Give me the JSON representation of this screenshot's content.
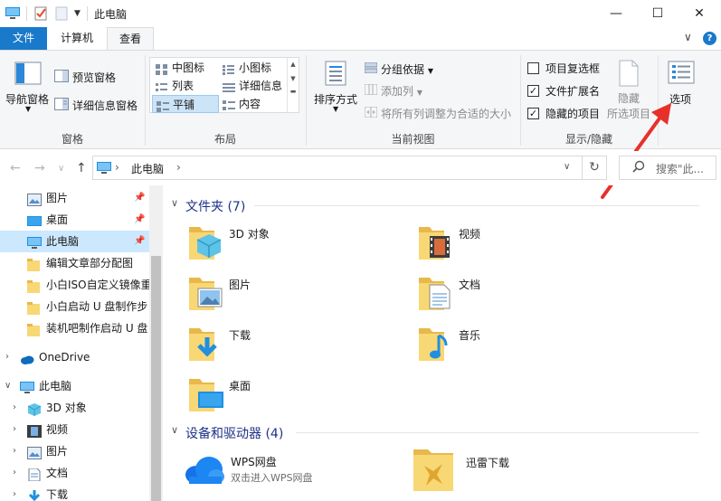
{
  "window": {
    "title": "此电脑",
    "controls": {
      "minimize": "—",
      "maximize": "☐",
      "close": "✕"
    }
  },
  "ribbon_tabs": {
    "file": "文件",
    "computer": "计算机",
    "view": "查看",
    "collapse": "∨",
    "help": "?"
  },
  "ribbon": {
    "panes": {
      "nav_pane": "导航窗格",
      "preview_pane": "预览窗格",
      "details_pane": "详细信息窗格",
      "group_label": "窗格"
    },
    "layout": {
      "items": [
        "中图标",
        "小图标",
        "列表",
        "详细信息",
        "平铺",
        "内容"
      ],
      "selected": "平铺",
      "group_label": "布局"
    },
    "current_view": {
      "sort_by": "排序方式",
      "group_by": "分组依据",
      "add_columns": "添加列",
      "fit_columns": "将所有列调整为合适的大小",
      "group_label": "当前视图"
    },
    "show_hide": {
      "item_checkboxes": "项目复选框",
      "item_checkboxes_checked": false,
      "file_extensions": "文件扩展名",
      "file_extensions_checked": true,
      "hidden_items": "隐藏的项目",
      "hidden_items_checked": true,
      "hide_selected_line1": "隐藏",
      "hide_selected_line2": "所选项目",
      "group_label": "显示/隐藏"
    },
    "options": "选项"
  },
  "navbar": {
    "back": "←",
    "forward": "→",
    "recent": "∨",
    "up": "↑",
    "path": "此电脑",
    "path_arrow": "›",
    "dropdown": "∨",
    "refresh": "↻",
    "search_placeholder": "搜索\"此..."
  },
  "sidebar": {
    "quick_access": [
      {
        "label": "图片",
        "pinned": true
      },
      {
        "label": "桌面",
        "pinned": true
      },
      {
        "label": "此电脑",
        "pinned": true
      },
      {
        "label": "编辑文章部分配图",
        "pinned": false
      },
      {
        "label": "小白ISO自定义镜像重",
        "pinned": false
      },
      {
        "label": "小白启动 U 盘制作步",
        "pinned": false
      },
      {
        "label": "装机吧制作启动 U 盘",
        "pinned": false
      }
    ],
    "onedrive": "OneDrive",
    "this_pc": "此电脑",
    "this_pc_children": [
      "3D 对象",
      "视频",
      "图片",
      "文档",
      "下载"
    ],
    "pin_glyph": "📌",
    "expand_glyph": "›",
    "expanded_glyph": "∨"
  },
  "main": {
    "folders_header": "文件夹 (7)",
    "folders": [
      {
        "label": "3D 对象",
        "icon": "3d-objects-icon"
      },
      {
        "label": "视频",
        "icon": "videos-icon"
      },
      {
        "label": "图片",
        "icon": "pictures-icon"
      },
      {
        "label": "文档",
        "icon": "documents-icon"
      },
      {
        "label": "下载",
        "icon": "downloads-icon"
      },
      {
        "label": "音乐",
        "icon": "music-icon"
      },
      {
        "label": "桌面",
        "icon": "desktop-icon"
      }
    ],
    "devices_header": "设备和驱动器 (4)",
    "devices": [
      {
        "label": "WPS网盘",
        "sub": "双击进入WPS网盘",
        "icon": "wps-cloud-icon"
      },
      {
        "label": "迅雷下载",
        "sub": "",
        "icon": "xunlei-icon"
      }
    ],
    "collapse_glyph": "∨"
  },
  "colors": {
    "accent": "#1979ca",
    "selection": "#cce8ff",
    "folder": "#f8d775",
    "header_text": "#1e3287",
    "arrow": "#e8302a"
  }
}
